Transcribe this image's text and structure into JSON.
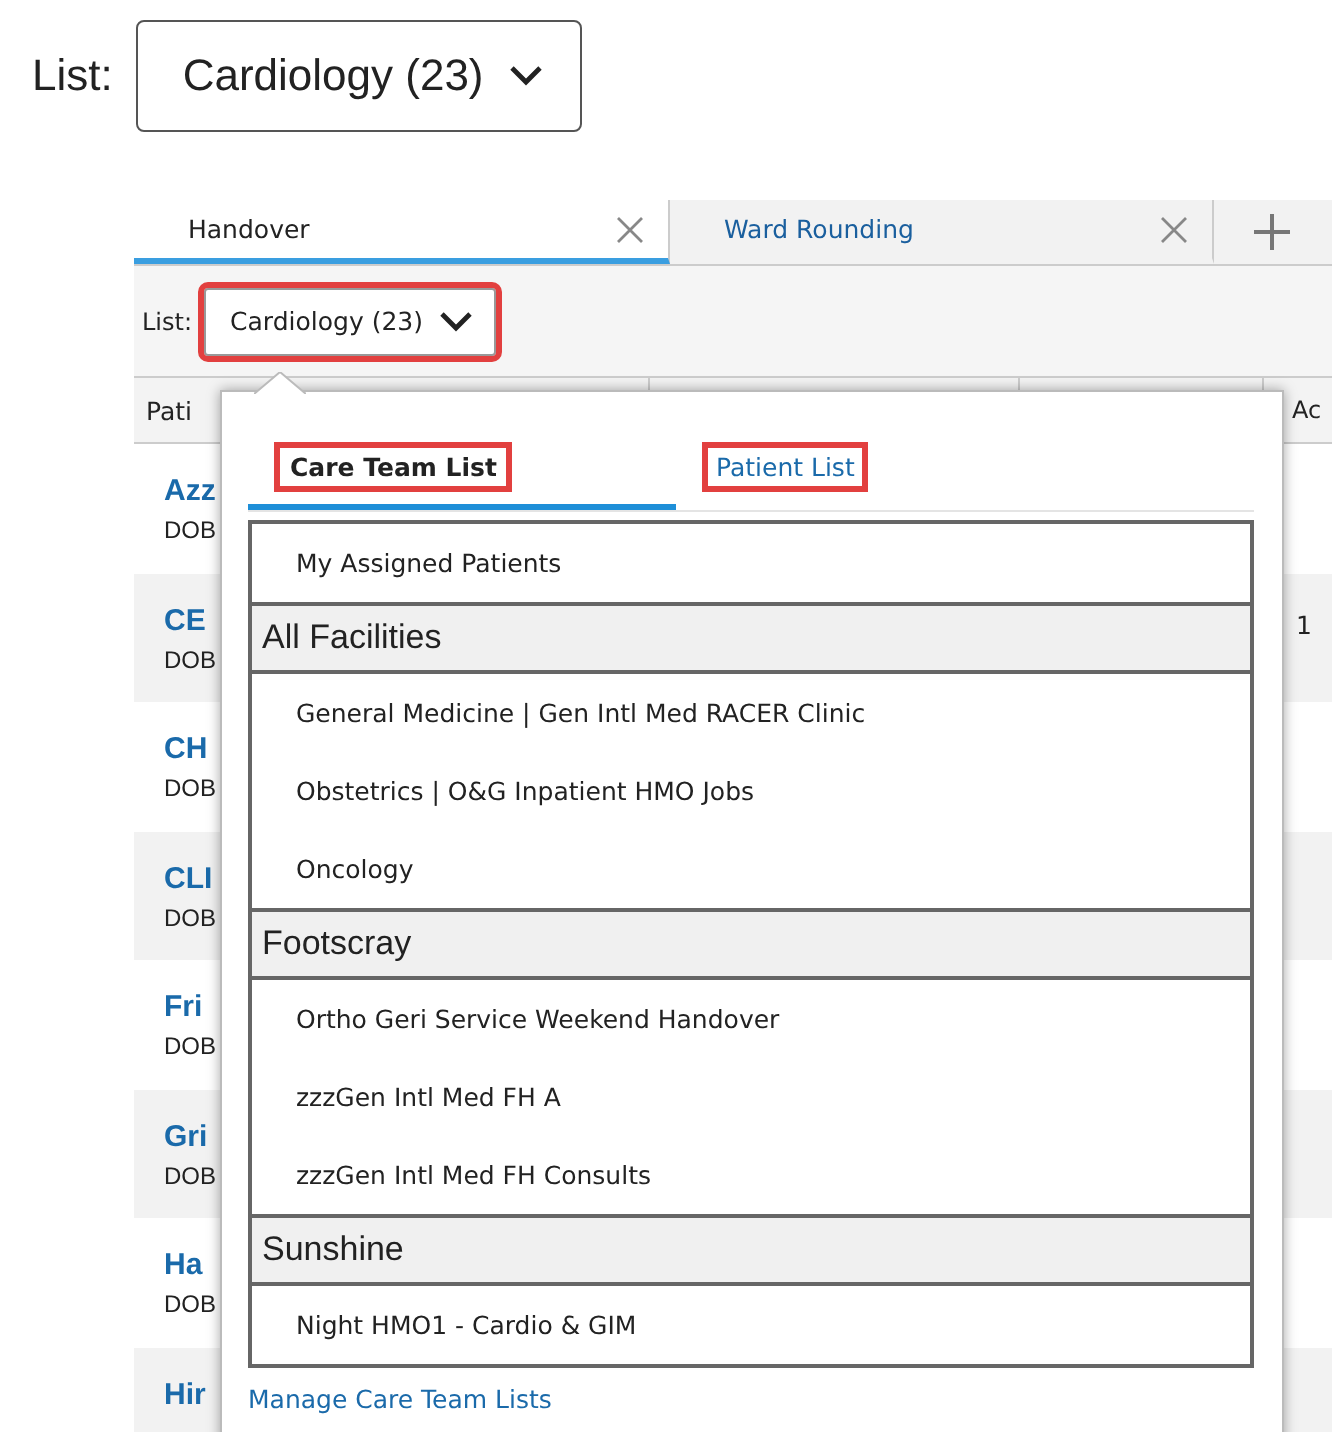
{
  "list_picker": {
    "label": "List:",
    "value": "Cardiology (23)"
  },
  "tabs": [
    {
      "label": "Handover",
      "selected": true
    },
    {
      "label": "Ward Rounding",
      "selected": false
    }
  ],
  "toolbar": {
    "label": "List:",
    "value": "Cardiology (23)",
    "highlighted": true
  },
  "table": {
    "columns": [
      "Pati",
      "Ac"
    ],
    "rows": [
      {
        "name": "Azz",
        "dob": "DOB",
        "column_5": ""
      },
      {
        "name": "CE",
        "dob": "DOB",
        "column_5": "1"
      },
      {
        "name": "CH",
        "dob": "DOB"
      },
      {
        "name": "CLI",
        "dob": "DOB"
      },
      {
        "name": "Fri",
        "dob": "DOB"
      },
      {
        "name": "Gri",
        "dob": "DOB"
      },
      {
        "name": "Ha",
        "dob": "DOB"
      },
      {
        "name": "Hir"
      }
    ]
  },
  "popup": {
    "tabs": [
      {
        "label": "Care Team List",
        "selected": true,
        "highlighted": true
      },
      {
        "label": "Patient List",
        "selected": false,
        "highlighted": true
      }
    ],
    "lists": [
      {
        "kind": "item",
        "label": "My Assigned Patients"
      },
      {
        "kind": "group",
        "label": "All Facilities",
        "children": [
          {
            "label": "General Medicine | Gen Intl Med RACER Clinic"
          },
          {
            "label": "Obstetrics | O&G Inpatient HMO Jobs"
          },
          {
            "label": "Oncology"
          }
        ]
      },
      {
        "kind": "group",
        "label": "Footscray",
        "children": [
          {
            "label": "Ortho Geri Service Weekend Handover"
          },
          {
            "label": "zzzGen Intl Med FH A"
          },
          {
            "label": "zzzGen Intl Med FH Consults"
          }
        ]
      },
      {
        "kind": "group",
        "label": "Sunshine",
        "children": [
          {
            "label": "Night HMO1 - Cardio & GIM"
          }
        ]
      }
    ],
    "footer_link": "Manage Care Team Lists"
  }
}
